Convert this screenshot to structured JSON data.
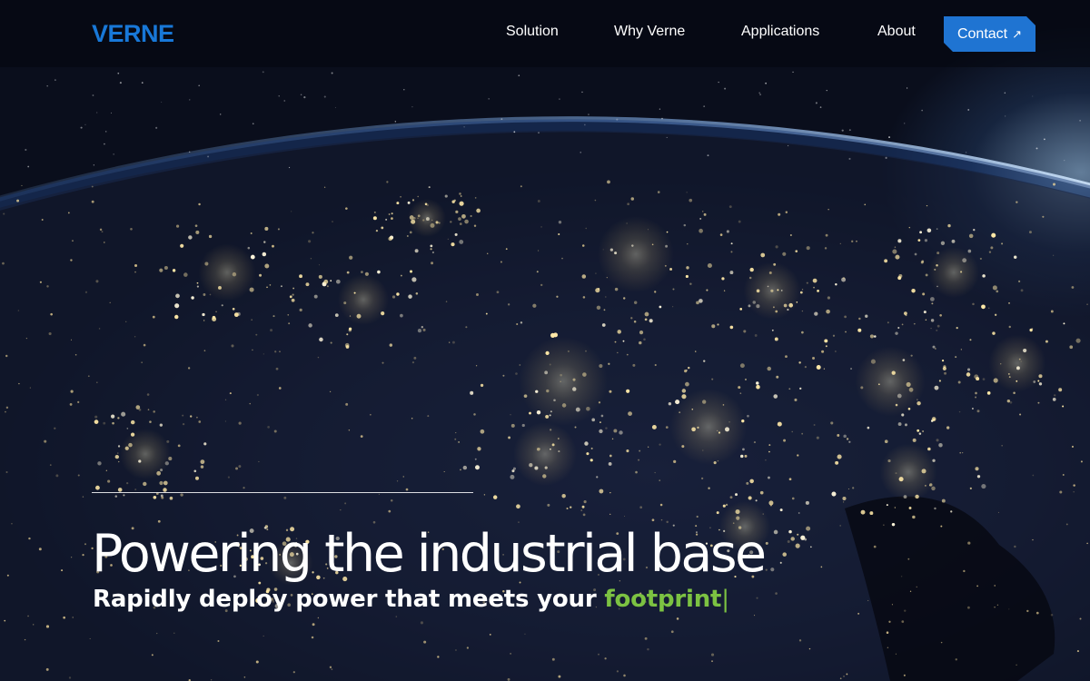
{
  "brand": {
    "logo_text": "VERNE",
    "color": "#1878d8"
  },
  "nav": {
    "items": [
      {
        "label": "Solution"
      },
      {
        "label": "Why Verne"
      },
      {
        "label": "Applications"
      },
      {
        "label": "About"
      }
    ],
    "contact_label": "Contact",
    "contact_icon": "arrow-up-right-icon",
    "contact_color": "#1f74d2"
  },
  "hero": {
    "background_image": "earth-at-night-city-lights",
    "headline": "Powering the industrial base",
    "subline_prefix": "Rapidly deploy power that meets your",
    "subline_highlight": "footprint",
    "cursor": "|",
    "highlight_color": "#7cc242"
  }
}
